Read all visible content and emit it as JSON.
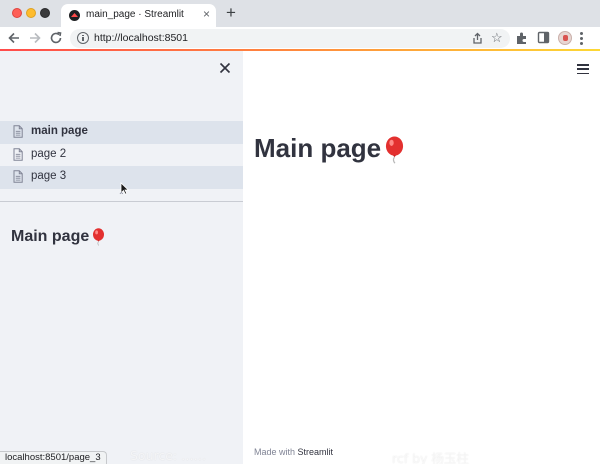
{
  "browser": {
    "tab_title": "main_page · Streamlit",
    "tab_close": "×",
    "new_tab": "+",
    "url": "http://localhost:8501",
    "status_url": "localhost:8501/page_3"
  },
  "sidebar": {
    "nav_items": [
      {
        "label": "main page",
        "state": "active"
      },
      {
        "label": "page 2",
        "state": "default"
      },
      {
        "label": "page 3",
        "state": "hover"
      }
    ],
    "heading": "Main page"
  },
  "main": {
    "heading": "Main page",
    "footer_prefix": "Made with ",
    "footer_brand": "Streamlit"
  },
  "watermark": {
    "left": "Source: ……",
    "right": "rcf by 杨玉柱"
  },
  "icons": {
    "balloon": "balloon-icon",
    "page": "page-icon",
    "close": "close-icon",
    "menu": "hamburger-icon"
  },
  "colors": {
    "sidebar_bg": "#f0f2f6",
    "nav_active_bg": "#dde3ec",
    "text": "#31333f",
    "accent": "#ff4b4b"
  }
}
